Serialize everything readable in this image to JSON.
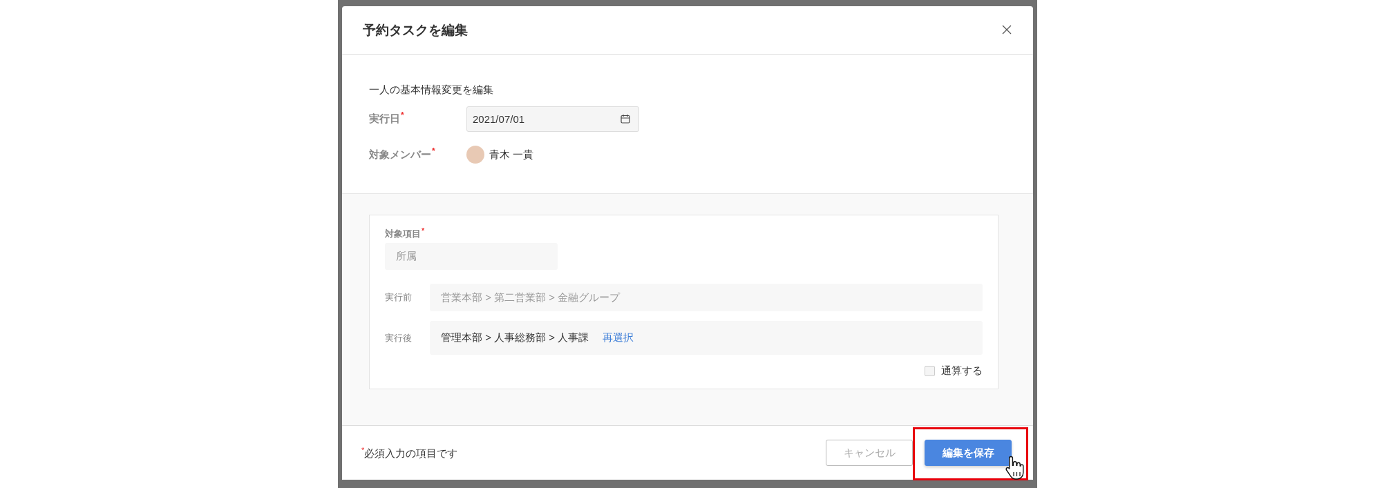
{
  "dialog": {
    "title": "予約タスクを編集",
    "subtitle": "一人の基本情報変更を編集",
    "fields": [
      {
        "label": "実行日",
        "required_mark": "*",
        "kind": "date",
        "value": "2021/07/01"
      },
      {
        "label": "対象メンバー",
        "required_mark": "*",
        "kind": "member",
        "value": "青木 一貴"
      }
    ],
    "item_panel": {
      "label": "対象項目",
      "required_mark": "*",
      "value": "所属",
      "rows": [
        {
          "label": "実行前",
          "value": "営業本部 > 第二営業部 > 金融グループ",
          "disabled": true
        },
        {
          "label": "実行後",
          "value": "管理本部 > 人事総務部 > 人事課",
          "disabled": false,
          "link": "再選択"
        }
      ],
      "checkbox": {
        "label": "通算する",
        "checked": false
      }
    },
    "footer": {
      "note_mark": "*",
      "note": "必須入力の項目です",
      "buttons": [
        {
          "label": "キャンセル",
          "kind": "secondary",
          "highlighted": false
        },
        {
          "label": "編集を保存",
          "kind": "primary",
          "highlighted": true
        }
      ]
    }
  }
}
